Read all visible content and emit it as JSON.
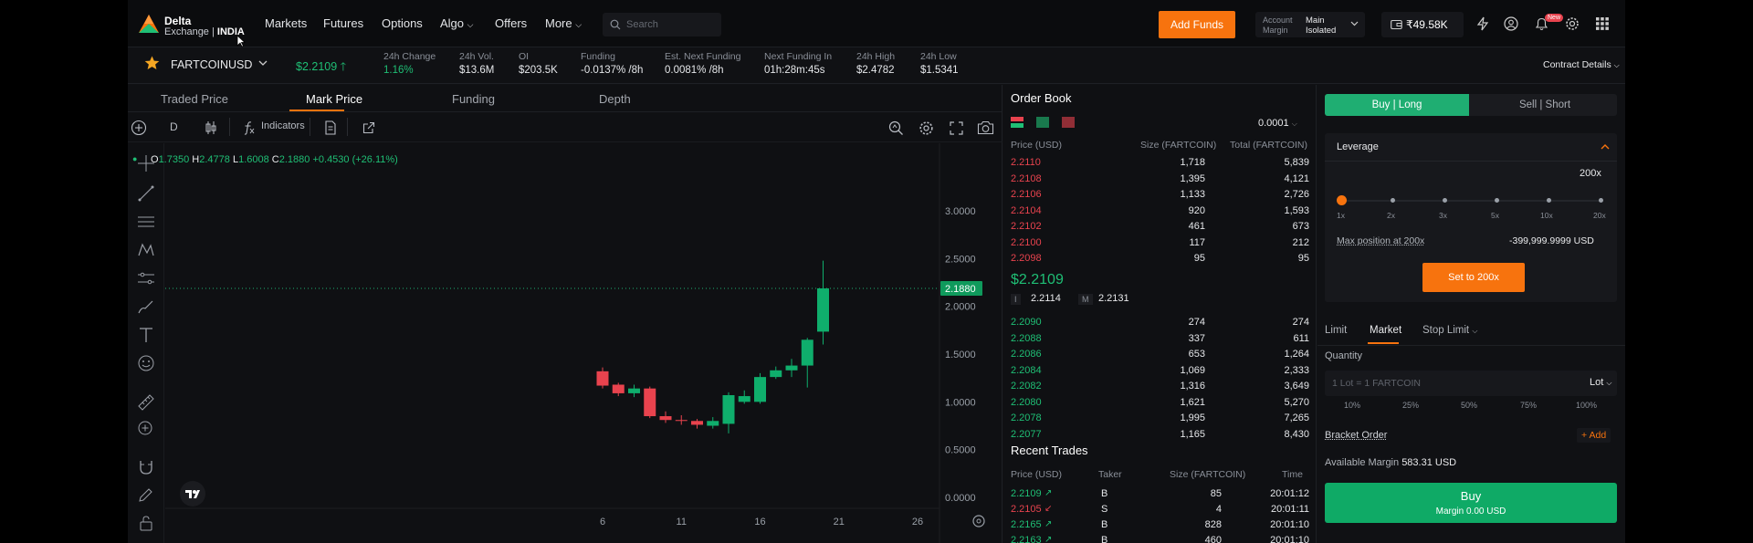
{
  "brand": {
    "name": "Delta",
    "sub": "Exchange",
    "region": "INDIA"
  },
  "nav": [
    "Markets",
    "Futures",
    "Options",
    "Algo",
    "Offers",
    "More"
  ],
  "search": {
    "placeholder": "Search"
  },
  "header": {
    "add_funds": "Add Funds",
    "account_label": "Account",
    "margin_label": "Margin",
    "account_value": "Main",
    "margin_value": "Isolated",
    "balance": "₹49.58K",
    "new_badge": "New"
  },
  "ticker": {
    "symbol": "FARTCOINUSD",
    "price": "$2.2109",
    "stats": [
      {
        "label": "24h Change",
        "value": "1.16%"
      },
      {
        "label": "24h Vol.",
        "value": "$13.6M"
      },
      {
        "label": "OI",
        "value": "$203.5K"
      },
      {
        "label": "Funding",
        "value": "-0.0137% /8h"
      },
      {
        "label": "Est. Next Funding",
        "value": "0.0081% /8h"
      },
      {
        "label": "Next Funding In",
        "value": "01h:28m:45s"
      },
      {
        "label": "24h High",
        "value": "$2.4782"
      },
      {
        "label": "24h Low",
        "value": "$1.5341"
      }
    ],
    "contract_details": "Contract Details"
  },
  "chart_tabs": [
    "Traded Price",
    "Mark Price",
    "Funding",
    "Depth"
  ],
  "chart_toolbar": {
    "interval": "D",
    "indicators": "Indicators"
  },
  "ohlc": {
    "o_label": "O",
    "o": "1.7350",
    "h_label": "H",
    "h": "2.4778",
    "l_label": "L",
    "l": "1.6008",
    "c_label": "C",
    "c": "2.1880",
    "change": "+0.4530 (+26.11%)"
  },
  "chart_data": {
    "type": "candlestick",
    "y_ticks": [
      "3.0000",
      "2.5000",
      "2.0000",
      "1.5000",
      "1.0000",
      "0.5000",
      "0.0000"
    ],
    "ylim": [
      0,
      3
    ],
    "x_ticks": [
      {
        "label": "6",
        "day": 6
      },
      {
        "label": "11",
        "day": 11
      },
      {
        "label": "16",
        "day": 16
      },
      {
        "label": "21",
        "day": 21
      },
      {
        "label": "26",
        "day": 26
      }
    ],
    "last_price_label": "2.1880",
    "last_price": 2.188,
    "candles": [
      {
        "day": 6,
        "o": 1.32,
        "h": 1.36,
        "l": 1.14,
        "c": 1.17
      },
      {
        "day": 7,
        "o": 1.18,
        "h": 1.2,
        "l": 1.06,
        "c": 1.09
      },
      {
        "day": 8,
        "o": 1.09,
        "h": 1.18,
        "l": 1.05,
        "c": 1.14
      },
      {
        "day": 9,
        "o": 1.14,
        "h": 1.16,
        "l": 0.83,
        "c": 0.85
      },
      {
        "day": 10,
        "o": 0.85,
        "h": 0.9,
        "l": 0.78,
        "c": 0.81
      },
      {
        "day": 11,
        "o": 0.81,
        "h": 0.86,
        "l": 0.76,
        "c": 0.8
      },
      {
        "day": 12,
        "o": 0.8,
        "h": 0.82,
        "l": 0.72,
        "c": 0.76
      },
      {
        "day": 13,
        "o": 0.75,
        "h": 0.84,
        "l": 0.72,
        "c": 0.8
      },
      {
        "day": 14,
        "o": 0.77,
        "h": 1.1,
        "l": 0.67,
        "c": 1.07
      },
      {
        "day": 15,
        "o": 1.0,
        "h": 1.12,
        "l": 0.98,
        "c": 1.06
      },
      {
        "day": 16,
        "o": 1.0,
        "h": 1.3,
        "l": 0.98,
        "c": 1.26
      },
      {
        "day": 17,
        "o": 1.26,
        "h": 1.37,
        "l": 1.24,
        "c": 1.33
      },
      {
        "day": 18,
        "o": 1.33,
        "h": 1.45,
        "l": 1.26,
        "c": 1.38
      },
      {
        "day": 19,
        "o": 1.38,
        "h": 1.67,
        "l": 1.15,
        "c": 1.65
      },
      {
        "day": 20,
        "o": 1.735,
        "h": 2.4778,
        "l": 1.6008,
        "c": 2.188
      }
    ]
  },
  "order_book": {
    "title": "Order Book",
    "tick_size": "0.0001",
    "headers": [
      "Price (USD)",
      "Size (FARTCOIN)",
      "Total (FARTCOIN)"
    ],
    "asks": [
      [
        "2.2110",
        "1,718",
        "5,839"
      ],
      [
        "2.2108",
        "1,395",
        "4,121"
      ],
      [
        "2.2106",
        "1,133",
        "2,726"
      ],
      [
        "2.2104",
        "920",
        "1,593"
      ],
      [
        "2.2102",
        "461",
        "673"
      ],
      [
        "2.2100",
        "117",
        "212"
      ],
      [
        "2.2098",
        "95",
        "95"
      ]
    ],
    "last_price": "$2.2109",
    "index_label": "I",
    "index_price": "2.2114",
    "mark_label": "M",
    "mark_price": "2.2131",
    "bids": [
      [
        "2.2090",
        "274",
        "274"
      ],
      [
        "2.2088",
        "337",
        "611"
      ],
      [
        "2.2086",
        "653",
        "1,264"
      ],
      [
        "2.2084",
        "1,069",
        "2,333"
      ],
      [
        "2.2082",
        "1,316",
        "3,649"
      ],
      [
        "2.2080",
        "1,621",
        "5,270"
      ],
      [
        "2.2078",
        "1,995",
        "7,265"
      ],
      [
        "2.2077",
        "1,165",
        "8,430"
      ]
    ]
  },
  "recent_trades": {
    "title": "Recent Trades",
    "headers": [
      "Price (USD)",
      "Taker",
      "Size (FARTCOIN)",
      "Time"
    ],
    "rows": [
      {
        "price": "2.2109",
        "side": "up",
        "taker": "B",
        "size": "85",
        "time": "20:01:12"
      },
      {
        "price": "2.2105",
        "side": "down",
        "taker": "S",
        "size": "4",
        "time": "20:01:11"
      },
      {
        "price": "2.2165",
        "side": "up",
        "taker": "B",
        "size": "828",
        "time": "20:01:10"
      },
      {
        "price": "2.2163",
        "side": "up",
        "taker": "B",
        "size": "460",
        "time": "20:01:10"
      }
    ]
  },
  "trade_panel": {
    "buy_long": "Buy | Long",
    "sell_short": "Sell | Short",
    "leverage_title": "Leverage",
    "leverage_value": "200x",
    "leverage_marks": [
      "1x",
      "2x",
      "3x",
      "5x",
      "10x",
      "20x"
    ],
    "max_position_label": "Max position at 200x",
    "max_position_value": "-399,999.9999 USD",
    "set_button": "Set to 200x",
    "order_types": [
      "Limit",
      "Market",
      "Stop Limit"
    ],
    "quantity_label": "Quantity",
    "quantity_placeholder": "1 Lot = 1 FARTCOIN",
    "unit": "Lot",
    "percents": [
      "10%",
      "25%",
      "50%",
      "75%",
      "100%"
    ],
    "bracket_order": "Bracket Order",
    "add": "Add",
    "available_margin_label": "Available Margin",
    "available_margin_value": "583.31 USD",
    "buy_label": "Buy",
    "buy_margin": "Margin 0.00 USD"
  }
}
